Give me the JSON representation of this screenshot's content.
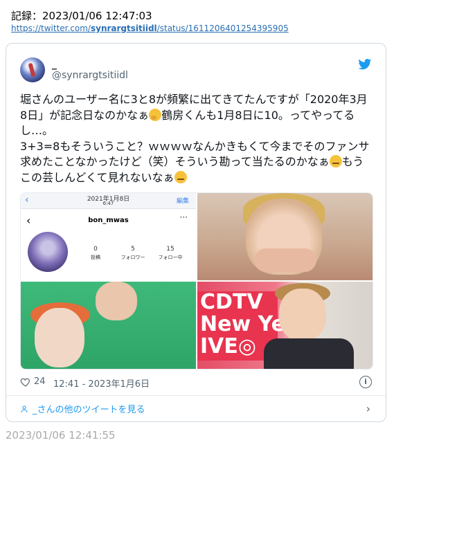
{
  "record": "記録：2023/01/06 12:47:03",
  "url": {
    "prefix": "https://twitter.com/",
    "user": "synrargtsitiidl",
    "suffix": "/status/1611206401254395905"
  },
  "tweet": {
    "display_name": "_",
    "handle": "@synrargtsitiidl",
    "text_parts": [
      "堀さんのユーザー名に3と8が頻繁に出てきてたんですが「2020年3月8日」が記念日なのかなぁ",
      "鶴房くんも1月8日に10。ってやってるし…。\n3+3=8もそういうこと？ｗｗｗｗなんかきもくて今までそのファンサ求めたことなかったけど（笑）そういう勘って当たるのかなぁ",
      "もうこの芸しんどくて見れないなぁ"
    ],
    "likes": "24",
    "timestamp": "12:41 - 2023年1月6日",
    "more_link": "_さんの他のツイートを見る"
  },
  "media": {
    "screenshot": {
      "date": "2021年1月8日",
      "time": "6:47",
      "edit": "編集",
      "username": "bon_mwas",
      "stats": [
        {
          "value": "0",
          "label": "投稿"
        },
        {
          "value": "5",
          "label": "フォロワー"
        },
        {
          "value": "15",
          "label": "フォロー中"
        }
      ]
    },
    "sign_text": "CDTV\nNew Ye\nIVE◎"
  },
  "footer_time": "2023/01/06 12:41:55",
  "colors": {
    "link": "#2a6fb4",
    "twitter_blue": "#1d9bf0",
    "muted": "#536471",
    "border": "#cfd9de"
  },
  "icons": [
    "twitter-bird-icon",
    "heart-icon",
    "info-icon",
    "person-icon",
    "chevron-right-icon",
    "thinking-face-emoji",
    "persevering-face-emoji"
  ]
}
